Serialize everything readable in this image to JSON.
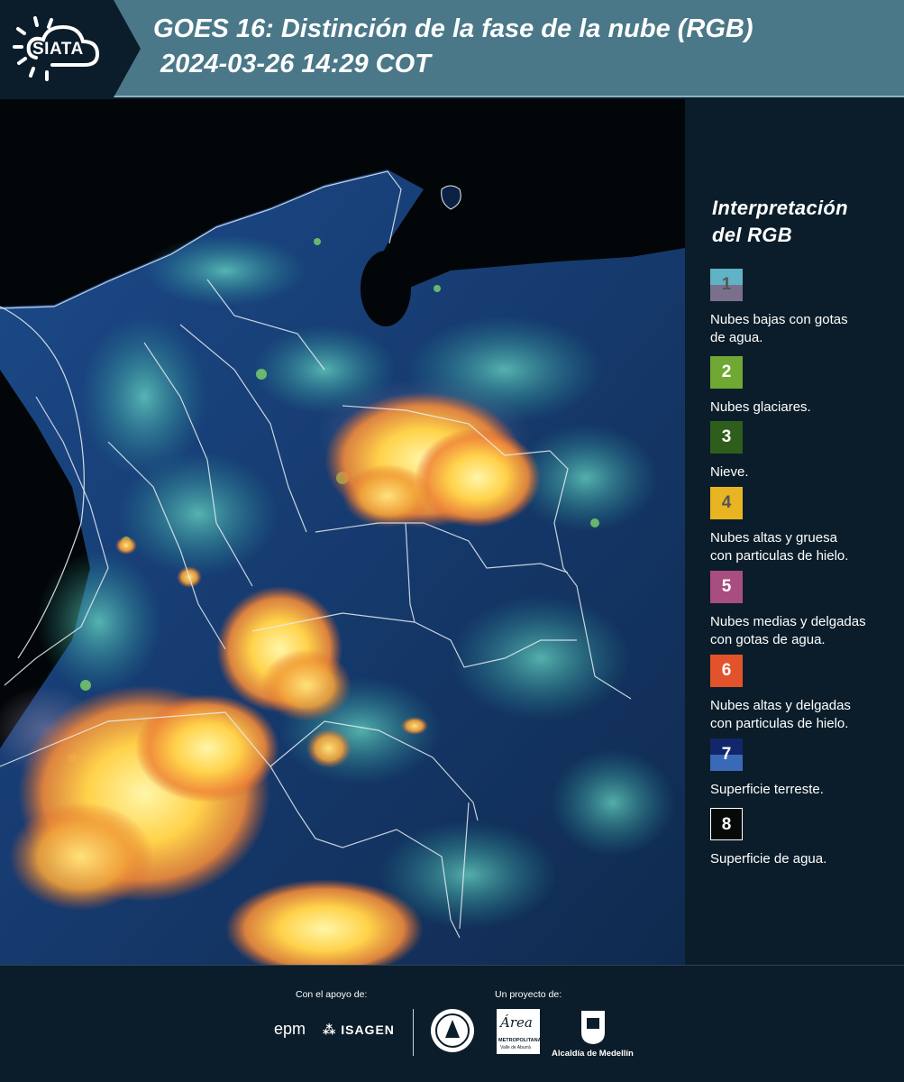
{
  "header": {
    "logo_text": "SIATA",
    "title_line1": "GOES 16: Distinción de la fase de la nube (RGB)",
    "title_line2": "2024-03-26 14:29 COT"
  },
  "legend": {
    "title_line1": "Interpretación",
    "title_line2": "del RGB",
    "items": [
      {
        "number": "1",
        "label_line1": "Nubes bajas con gotas",
        "label_line2": "de agua.",
        "color_top": "#5fb3c4",
        "color_bottom": "#7a6f8c",
        "text_color": "#555555"
      },
      {
        "number": "2",
        "label_line1": "Nubes glaciares.",
        "label_line2": "",
        "color_top": "#6fa832",
        "color_bottom": "#6fa832",
        "text_color": "#ffffff"
      },
      {
        "number": "3",
        "label_line1": "Nieve.",
        "label_line2": "",
        "color_top": "#2f5e1c",
        "color_bottom": "#2f5e1c",
        "text_color": "#ffffff"
      },
      {
        "number": "4",
        "label_line1": "Nubes altas y gruesa",
        "label_line2": "con particulas de hielo.",
        "color_top": "#e8b422",
        "color_bottom": "#e8b422",
        "text_color": "#555555"
      },
      {
        "number": "5",
        "label_line1": "Nubes medias y delgadas",
        "label_line2": "con gotas de agua.",
        "color_top": "#a84d80",
        "color_bottom": "#a84d80",
        "text_color": "#ffffff"
      },
      {
        "number": "6",
        "label_line1": "Nubes altas y delgadas",
        "label_line2": "con particulas de hielo.",
        "color_top": "#e2532c",
        "color_bottom": "#e2532c",
        "text_color": "#ffffff"
      },
      {
        "number": "7",
        "label_line1": "Superficie terreste.",
        "label_line2": "",
        "color_top": "#12266a",
        "color_bottom": "#3a69b8",
        "text_color": "#ffffff"
      },
      {
        "number": "8",
        "label_line1": "Superficie de agua.",
        "label_line2": "",
        "color_top": "#050a08",
        "color_bottom": "#050a08",
        "text_color": "#ffffff"
      }
    ]
  },
  "footer": {
    "support_label": "Con el apoyo de:",
    "project_label": "Un proyecto de:",
    "sponsor1": "epm",
    "sponsor2": "ISAGEN",
    "partner_amva_script": "Área",
    "partner_amva_line1": "METROPOLITANA",
    "partner_amva_line2": "Valle de Aburrá",
    "partner_alcaldia": "Alcaldía de Medellín"
  },
  "colors": {
    "background": "#0b1d2a",
    "header": "#4a7888",
    "cloud_ice_thick": "#f5b43a",
    "land": "#1a3a6a",
    "water": "#030608"
  }
}
